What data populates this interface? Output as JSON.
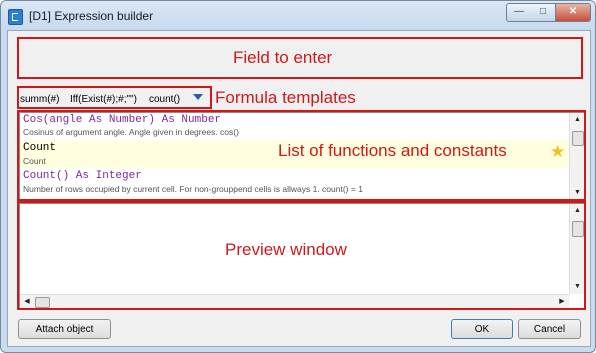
{
  "window": {
    "title": "[D1] Expression builder",
    "controls": {
      "minimize": "—",
      "maximize": "□",
      "close": "✕"
    }
  },
  "annotations": {
    "field_to_enter": "Field to enter",
    "formula_templates": "Formula templates",
    "functions_list": "List of functions and constants",
    "preview_window": "Preview window"
  },
  "templates": {
    "items": [
      "summ(#)",
      "Iff(Exist(#);#;\"\")",
      "count()"
    ]
  },
  "functions": [
    {
      "name": "Cos(angle As Number) As Number",
      "description": "Cosinus of argument angle. Angle given in degrees. cos()",
      "selected": false
    },
    {
      "name": "Count",
      "description": "Count",
      "selected": true
    },
    {
      "name": "Count() As Integer",
      "description": "Number of rows occupied by current cell. For non-grouppend cells is allways 1. count() = 1",
      "selected": false
    }
  ],
  "buttons": {
    "attach": "Attach object",
    "ok": "OK",
    "cancel": "Cancel"
  },
  "colors": {
    "annotation": "#d01818",
    "function_name": "#7a2a9a",
    "selected_row": "#ffffe0",
    "titlebar": "#c9dcef"
  }
}
